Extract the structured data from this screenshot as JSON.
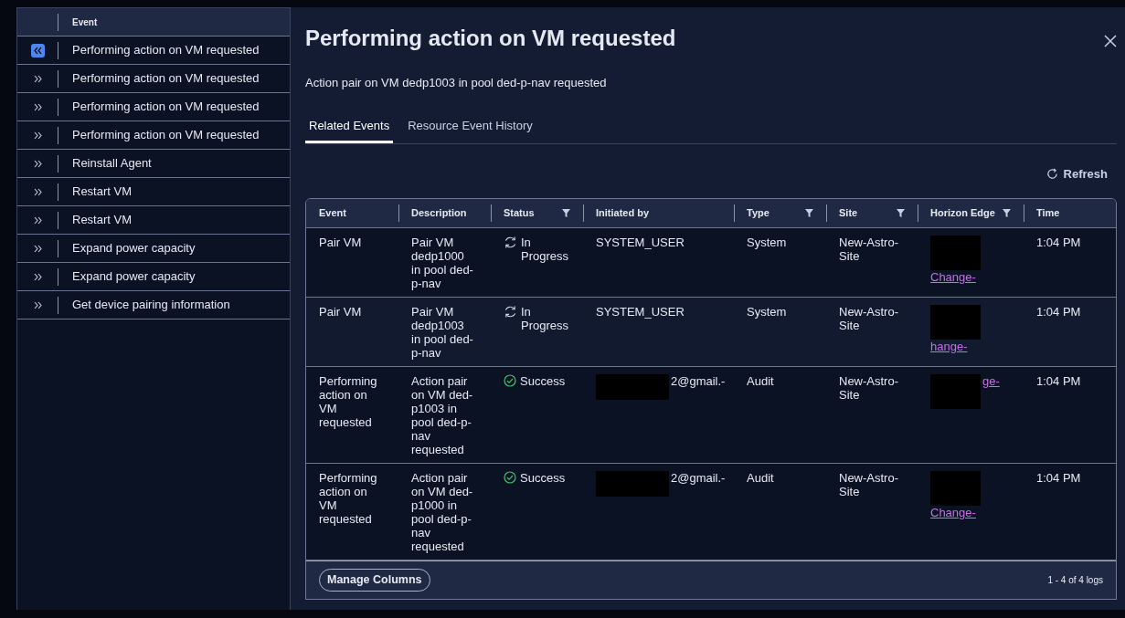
{
  "event_list": {
    "header": "Event",
    "items": [
      {
        "label": "Performing action on VM requested",
        "selected": true
      },
      {
        "label": "Performing action on VM requested",
        "selected": false
      },
      {
        "label": "Performing action on VM requested",
        "selected": false
      },
      {
        "label": "Performing action on VM requested",
        "selected": false
      },
      {
        "label": "Reinstall Agent",
        "selected": false
      },
      {
        "label": "Restart VM",
        "selected": false
      },
      {
        "label": "Restart VM",
        "selected": false
      },
      {
        "label": "Expand power capacity",
        "selected": false
      },
      {
        "label": "Expand power capacity",
        "selected": false
      },
      {
        "label": "Get device pairing information",
        "selected": false
      }
    ]
  },
  "detail": {
    "title": "Performing action on VM requested",
    "subtitle": "Action pair on VM dedp1003 in pool ded-p-nav requested",
    "tabs": [
      {
        "label": "Related Events",
        "selected": true
      },
      {
        "label": "Resource Event History",
        "selected": false
      }
    ],
    "refresh": "Refresh",
    "table": {
      "columns": [
        {
          "label": "Event",
          "filter": false
        },
        {
          "label": "Description",
          "filter": false
        },
        {
          "label": "Status",
          "filter": true
        },
        {
          "label": "Initiated by",
          "filter": false
        },
        {
          "label": "Type",
          "filter": true
        },
        {
          "label": "Site",
          "filter": true
        },
        {
          "label": "Horizon Edge",
          "filter": true
        },
        {
          "label": "Time",
          "filter": false
        }
      ],
      "rows": [
        {
          "event": "Pair VM",
          "description": "Pair VM dedp1000 in pool ded-p-nav",
          "status": {
            "kind": "in_progress",
            "label": "In Progress"
          },
          "initiated_by": "SYSTEM_USER",
          "redacted_initiator": false,
          "type": "System",
          "site": "New-Astro-Site",
          "horizon_edge": "Change-",
          "time": "1:04 PM"
        },
        {
          "event": "Pair VM",
          "description": "Pair VM dedp1003 in pool ded-p-nav",
          "status": {
            "kind": "in_progress",
            "label": "In Progress"
          },
          "initiated_by": "SYSTEM_USER",
          "redacted_initiator": false,
          "type": "System",
          "site": "New-Astro-Site",
          "horizon_edge": "hange-",
          "time": "1:04 PM"
        },
        {
          "event": "Performing action on VM requested",
          "description": "Action pair on VM ded-p1003 in pool ded-p-nav requested",
          "status": {
            "kind": "success",
            "label": "Success"
          },
          "initiated_by": "2@gmail.-",
          "redacted_initiator": true,
          "type": "Audit",
          "site": "New-Astro-Site",
          "horizon_edge": "ge-",
          "time": "1:04 PM"
        },
        {
          "event": "Performing action on VM requested",
          "description": "Action pair on VM ded-p1000 in pool ded-p-nav requested",
          "status": {
            "kind": "success",
            "label": "Success"
          },
          "initiated_by": "2@gmail.-",
          "redacted_initiator": true,
          "type": "Audit",
          "site": "New-Astro-Site",
          "horizon_edge": "Change-",
          "time": "1:04 PM"
        }
      ]
    },
    "manage_columns": "Manage Columns",
    "log_count": "1 - 4 of 4 logs"
  }
}
